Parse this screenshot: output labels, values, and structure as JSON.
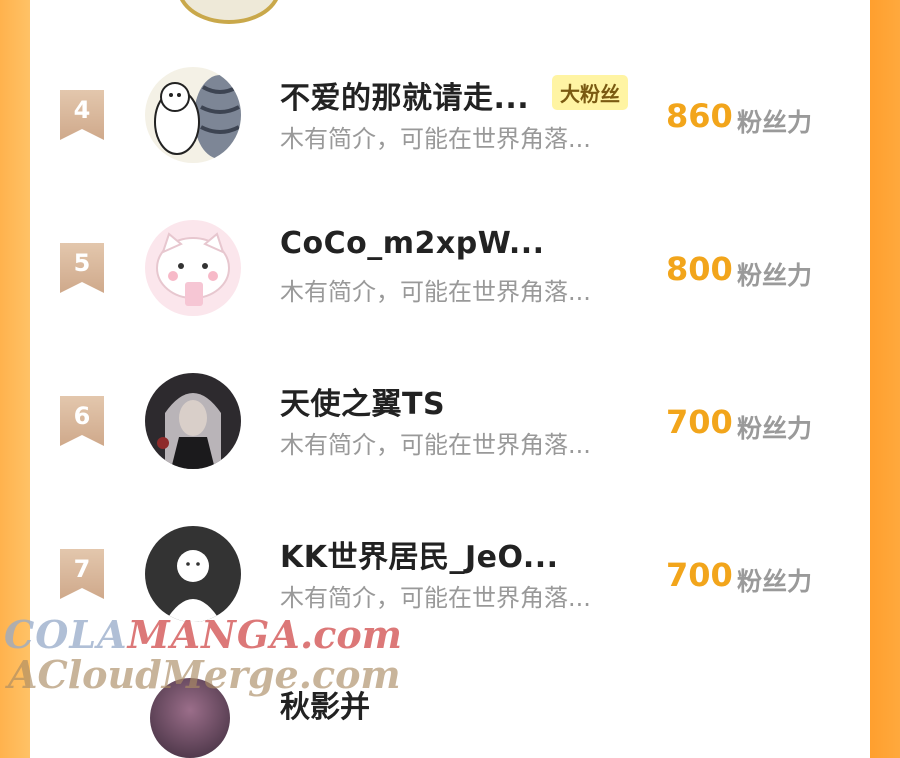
{
  "rows": [
    {
      "rank": "4",
      "name": "不爱的那就请走...",
      "badge": "大粉丝",
      "intro": "木有简介，可能在世界角落...",
      "score": "860",
      "unit": "粉丝力"
    },
    {
      "rank": "5",
      "name": "CoCo_m2xpW...",
      "intro": "木有简介，可能在世界角落...",
      "score": "800",
      "unit": "粉丝力"
    },
    {
      "rank": "6",
      "name": "天使之翼TS",
      "intro": "木有简介，可能在世界角落...",
      "score": "700",
      "unit": "粉丝力"
    },
    {
      "rank": "7",
      "name": "KK世界居民_JeO...",
      "intro": "木有简介，可能在世界角落...",
      "score": "700",
      "unit": "粉丝力"
    }
  ],
  "partial_row": {
    "name": "秋影并"
  },
  "watermark": {
    "line1_a": "COLA",
    "line1_b": "MANGA",
    "line1_c": ".com",
    "line2": "ACloudMerge.com"
  },
  "colors": {
    "score": "#f2a51b",
    "badge_bg": "#fff4a3",
    "rank_bg": "#cfa98b",
    "side_bar": "#ffa93d"
  }
}
